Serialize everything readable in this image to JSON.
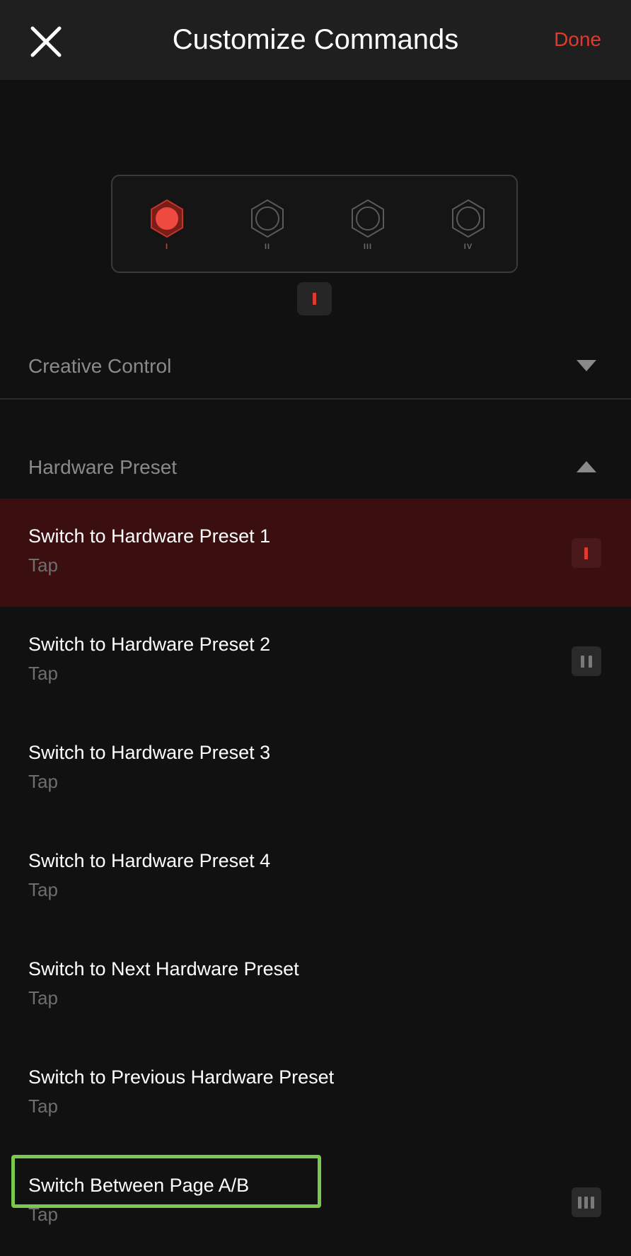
{
  "header": {
    "title": "Customize Commands",
    "done_label": "Done"
  },
  "device": {
    "switches": [
      {
        "label": "I",
        "active": true
      },
      {
        "label": "II",
        "active": false
      },
      {
        "label": "III",
        "active": false
      },
      {
        "label": "IV",
        "active": false
      }
    ],
    "current_page": "I"
  },
  "sections": {
    "creative_control": {
      "label": "Creative Control",
      "expanded": false
    },
    "hardware_preset": {
      "label": "Hardware Preset",
      "expanded": true
    }
  },
  "commands": [
    {
      "title": "Switch to Hardware Preset 1",
      "subtitle": "Tap",
      "badge": "I",
      "selected": true
    },
    {
      "title": "Switch to Hardware Preset 2",
      "subtitle": "Tap",
      "badge": "II",
      "selected": false
    },
    {
      "title": "Switch to Hardware Preset 3",
      "subtitle": "Tap",
      "badge": "",
      "selected": false
    },
    {
      "title": "Switch to Hardware Preset 4",
      "subtitle": "Tap",
      "badge": "",
      "selected": false
    },
    {
      "title": "Switch to Next Hardware Preset",
      "subtitle": "Tap",
      "badge": "",
      "selected": false
    },
    {
      "title": "Switch to Previous Hardware Preset",
      "subtitle": "Tap",
      "badge": "",
      "selected": false
    },
    {
      "title": "Switch Between Page A/B",
      "subtitle": "Tap",
      "badge": "III",
      "selected": false
    }
  ],
  "colors": {
    "accent": "#e0392e",
    "background": "#111111",
    "selected_row": "#3b0f0f",
    "highlight": "#7ac94f"
  }
}
